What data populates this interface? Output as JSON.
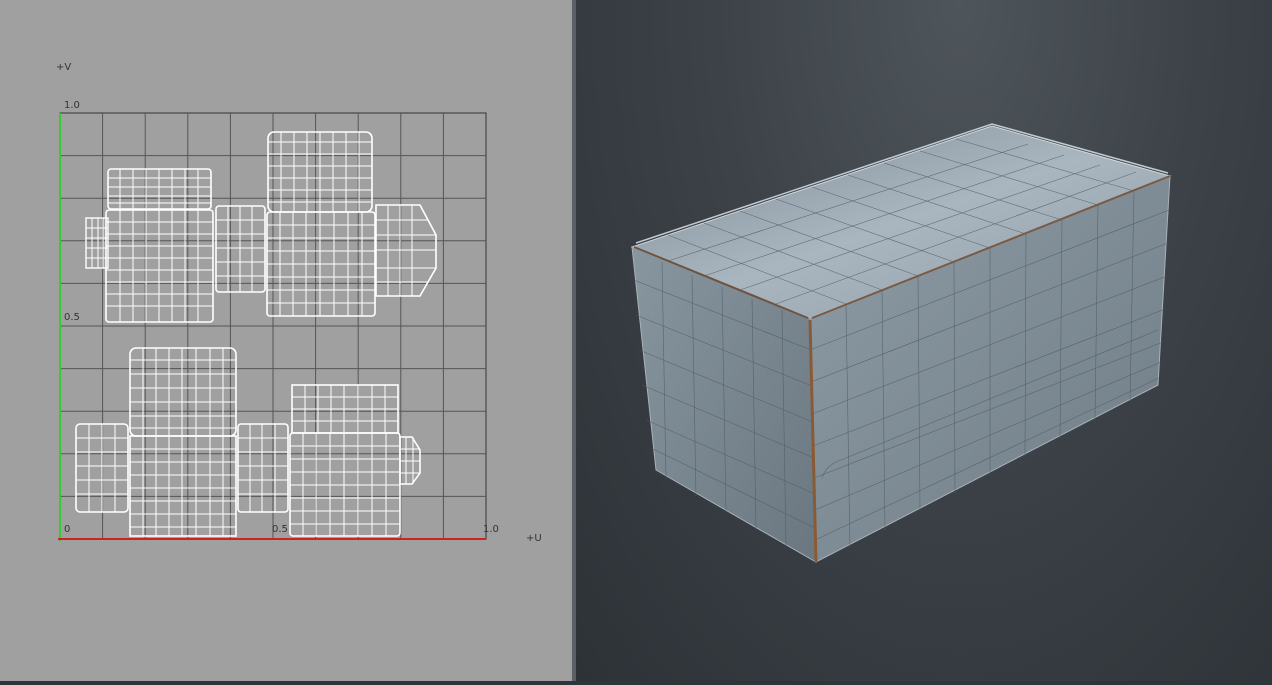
{
  "uv_editor": {
    "axis_v_label": "+V",
    "axis_u_label": "+U",
    "tick_v_top": "1.0",
    "tick_v_mid": "0.5",
    "tick_origin": "0",
    "tick_u_mid": "0.5",
    "tick_u_right": "1.0"
  },
  "colors": {
    "uv_background": "#a0a0a0",
    "grid_line": "#555555",
    "v_axis": "#33cc33",
    "u_axis": "#cc2222",
    "uv_wire": "#ffffff",
    "viewport_background": "#3a4046",
    "mesh_surface": "#8d9ba6",
    "seam_edge": "#8a5a36"
  },
  "viewport": {
    "object_icon": "box-mesh-icon"
  }
}
